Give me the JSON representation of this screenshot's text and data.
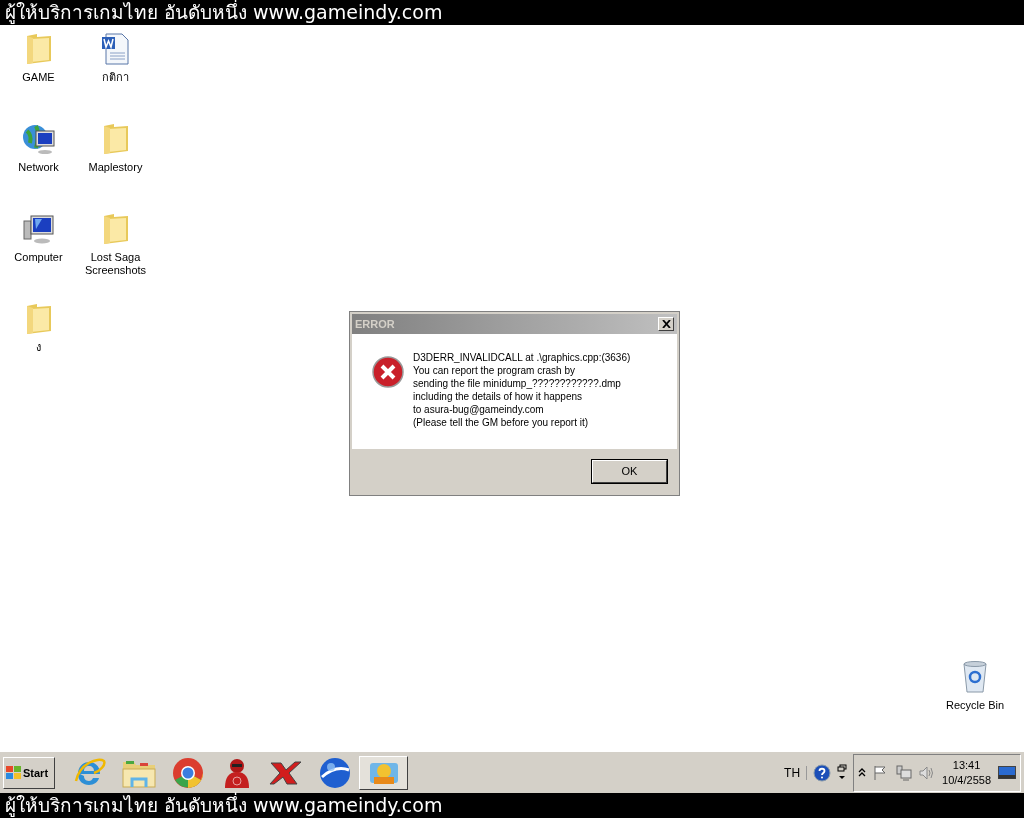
{
  "top_banner": {
    "text": "ผู้ให้บริการเกมไทย อันดับหนึ่ง www.gameindy.com"
  },
  "desktop_icons": [
    {
      "label": "GAME",
      "kind": "folder"
    },
    {
      "label": "กติกา",
      "kind": "document"
    },
    {
      "label": "Network",
      "kind": "network"
    },
    {
      "label": "Maplestory",
      "kind": "folder"
    },
    {
      "label": "Computer",
      "kind": "computer"
    },
    {
      "label": "Lost Saga Screenshots",
      "kind": "folder"
    },
    {
      "label": "ง",
      "kind": "folder"
    }
  ],
  "recycle_bin": {
    "label": "Recycle Bin"
  },
  "dialog": {
    "title": "ERROR",
    "lines": [
      "D3DERR_INVALIDCALL at .\\graphics.cpp:(3636)",
      "You can report the program crash by",
      "sending the file minidump_????????????.dmp",
      "including the details of how it happens",
      "to asura-bug@gameindy.com",
      "(Please tell the GM before you report it)"
    ],
    "button": "OK"
  },
  "taskbar": {
    "start": "Start",
    "apps": [
      {
        "kind": "browser",
        "selected": false
      },
      {
        "kind": "explorer",
        "selected": false
      },
      {
        "kind": "chrome",
        "selected": false
      },
      {
        "kind": "avatar",
        "selected": false
      },
      {
        "kind": "x",
        "selected": false
      },
      {
        "kind": "globe",
        "selected": false
      },
      {
        "kind": "game",
        "selected": true
      }
    ],
    "language": "TH",
    "time": "13:41",
    "date": "10/4/2558"
  },
  "bottom_banner": {
    "text": "ผู้ให้บริการเกมไทย อันดับหนึ่ง www.gameindy.com"
  }
}
